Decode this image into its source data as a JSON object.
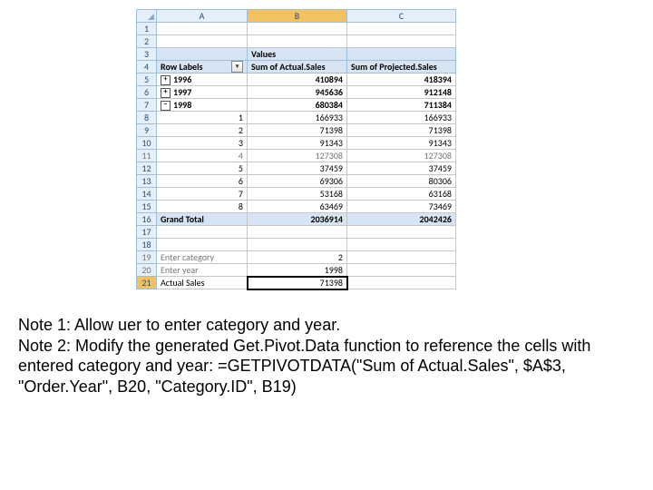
{
  "columns": {
    "a": "A",
    "b": "B",
    "c": "C"
  },
  "labels": {
    "values": "Values",
    "rowLabels": "Row Labels",
    "sumActual": "Sum of Actual.Sales",
    "sumProjected": "Sum of Projected.Sales",
    "plus": "+",
    "minus": "−"
  },
  "rows": {
    "r5": {
      "year": "1996",
      "b": "410894",
      "c": "418394"
    },
    "r6": {
      "year": "1997",
      "b": "945636",
      "c": "912148"
    },
    "r7": {
      "year": "1998",
      "b": "680384",
      "c": "711384"
    },
    "r8": {
      "a": "1",
      "b": "166933",
      "c": "166933"
    },
    "r9": {
      "a": "2",
      "b": "71398",
      "c": "71398"
    },
    "r10": {
      "a": "3",
      "b": "91343",
      "c": "91343"
    },
    "r11": {
      "a": "4",
      "b": "127308",
      "c": "127308"
    },
    "r12": {
      "a": "5",
      "b": "37459",
      "c": "37459"
    },
    "r13": {
      "a": "6",
      "b": "69306",
      "c": "80306"
    },
    "r14": {
      "a": "7",
      "b": "53168",
      "c": "63168"
    },
    "r15": {
      "a": "8",
      "b": "63469",
      "c": "73469"
    },
    "r16": {
      "a": "Grand Total",
      "b": "2036914",
      "c": "2042426"
    },
    "r19": {
      "a": "Enter category",
      "b": "2"
    },
    "r20": {
      "a": "Enter year",
      "b": "1998"
    },
    "r21": {
      "a": "Actual Sales",
      "b": "71398"
    }
  },
  "rownums": {
    "n1": "1",
    "n2": "2",
    "n3": "3",
    "n4": "4",
    "n5": "5",
    "n6": "6",
    "n7": "7",
    "n8": "8",
    "n9": "9",
    "n10": "10",
    "n11": "11",
    "n12": "12",
    "n13": "13",
    "n14": "14",
    "n15": "15",
    "n16": "16",
    "n17": "17",
    "n18": "18",
    "n19": "19",
    "n20": "20",
    "n21": "21"
  },
  "notes": {
    "n1": "Note 1: Allow uer to enter category and year.",
    "n2a": "Note 2: Modify the generated Get.Pivot.Data function to reference the cells with entered category and year: =GETPIVOTDATA(\"Sum of Actual.Sales\", $A$3, \"Order.Year\", B20, \"Category.ID\", B19)"
  }
}
